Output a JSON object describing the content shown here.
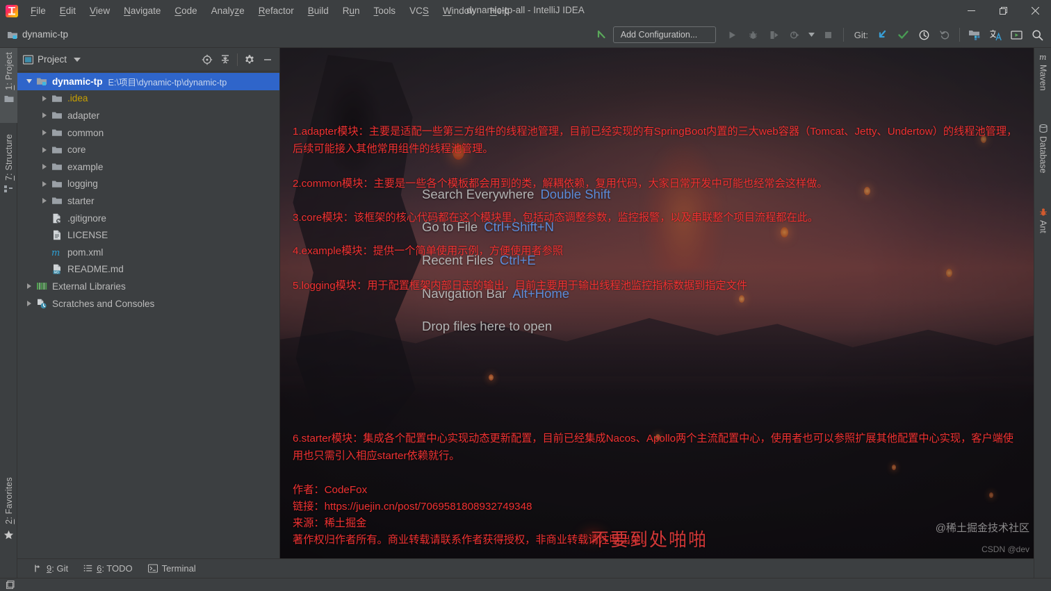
{
  "window": {
    "title": "dynamic-tp-all - IntelliJ IDEA",
    "minimize_tooltip": "Minimize",
    "restore_tooltip": "Restore",
    "close_tooltip": "Close"
  },
  "menubar": {
    "items": [
      {
        "label": "File",
        "mnemonic": "F"
      },
      {
        "label": "Edit",
        "mnemonic": "E"
      },
      {
        "label": "View",
        "mnemonic": "V"
      },
      {
        "label": "Navigate",
        "mnemonic": "N"
      },
      {
        "label": "Code",
        "mnemonic": "C"
      },
      {
        "label": "Analyze",
        "mnemonic": "z"
      },
      {
        "label": "Refactor",
        "mnemonic": "R"
      },
      {
        "label": "Build",
        "mnemonic": "B"
      },
      {
        "label": "Run",
        "mnemonic": "u"
      },
      {
        "label": "Tools",
        "mnemonic": "T"
      },
      {
        "label": "VCS",
        "mnemonic": "S"
      },
      {
        "label": "Window",
        "mnemonic": "W"
      },
      {
        "label": "Help",
        "mnemonic": "H"
      }
    ]
  },
  "toolbar": {
    "breadcrumb_project": "dynamic-tp",
    "run_configuration": "Add Configuration...",
    "git_label": "Git:",
    "icons": {
      "back": "back-arrow-icon",
      "run": "run-icon",
      "debug": "debug-icon",
      "run_coverage": "run-with-coverage-icon",
      "profile": "profiler-icon",
      "dropdown": "chevron-down-icon",
      "stop": "stop-icon",
      "update_project": "git-update-icon",
      "commit": "git-commit-icon",
      "history": "git-history-icon",
      "rollback": "git-rollback-icon",
      "project_structure": "project-structure-icon",
      "translate": "translate-icon",
      "presentation": "presentation-icon",
      "search": "search-icon"
    }
  },
  "left_stripe": {
    "items": [
      {
        "label": "1: Project",
        "mnemonic": "1",
        "icon": "project-folder-icon",
        "active": true
      },
      {
        "label": "7: Structure",
        "mnemonic": "7",
        "icon": "structure-icon",
        "active": false
      },
      {
        "label": "2: Favorites",
        "mnemonic": "2",
        "icon": "star-icon",
        "active": false
      }
    ]
  },
  "right_stripe": {
    "items": [
      {
        "label": "Maven",
        "icon": "maven-icon"
      },
      {
        "label": "Database",
        "icon": "database-icon"
      },
      {
        "label": "Ant",
        "icon": "ant-icon"
      }
    ]
  },
  "project_panel": {
    "title": "Project",
    "view_dropdown_icon": "chevron-down-icon",
    "actions": [
      {
        "name": "scroll-from-source-icon",
        "tooltip": "Select Opened File"
      },
      {
        "name": "collapse-all-icon",
        "tooltip": "Collapse All"
      },
      {
        "name": "gear-icon",
        "tooltip": "Settings"
      },
      {
        "name": "hide-icon",
        "tooltip": "Hide"
      }
    ],
    "tree": [
      {
        "label": "dynamic-tp",
        "suffix": "E:\\项目\\dynamic-tp\\dynamic-tp",
        "indent": 0,
        "twisty": "open",
        "icon": "project-folder-icon",
        "selected": true,
        "bold": true
      },
      {
        "label": ".idea",
        "suffix": "",
        "indent": 1,
        "twisty": "closed",
        "icon": "folder-icon",
        "selected": false,
        "color": "yellow"
      },
      {
        "label": "adapter",
        "suffix": "",
        "indent": 1,
        "twisty": "closed",
        "icon": "folder-icon",
        "selected": false
      },
      {
        "label": "common",
        "suffix": "",
        "indent": 1,
        "twisty": "closed",
        "icon": "folder-icon",
        "selected": false
      },
      {
        "label": "core",
        "suffix": "",
        "indent": 1,
        "twisty": "closed",
        "icon": "folder-icon",
        "selected": false
      },
      {
        "label": "example",
        "suffix": "",
        "indent": 1,
        "twisty": "closed",
        "icon": "folder-icon",
        "selected": false
      },
      {
        "label": "logging",
        "suffix": "",
        "indent": 1,
        "twisty": "closed",
        "icon": "folder-icon",
        "selected": false
      },
      {
        "label": "starter",
        "suffix": "",
        "indent": 1,
        "twisty": "closed",
        "icon": "folder-icon",
        "selected": false
      },
      {
        "label": ".gitignore",
        "suffix": "",
        "indent": 1,
        "twisty": "none",
        "icon": "gitignore-file-icon",
        "selected": false
      },
      {
        "label": "LICENSE",
        "suffix": "",
        "indent": 1,
        "twisty": "none",
        "icon": "text-file-icon",
        "selected": false
      },
      {
        "label": "pom.xml",
        "suffix": "",
        "indent": 1,
        "twisty": "none",
        "icon": "maven-pom-icon",
        "selected": false
      },
      {
        "label": "README.md",
        "suffix": "",
        "indent": 1,
        "twisty": "none",
        "icon": "markdown-file-icon",
        "selected": false
      },
      {
        "label": "External Libraries",
        "suffix": "",
        "indent": 0,
        "twisty": "closed",
        "icon": "libraries-icon",
        "selected": false
      },
      {
        "label": "Scratches and Consoles",
        "suffix": "",
        "indent": 0,
        "twisty": "closed",
        "icon": "scratches-icon",
        "selected": false
      }
    ]
  },
  "editor": {
    "red_notes": [
      "1.adapter模块：主要是适配一些第三方组件的线程池管理，目前已经实现的有SpringBoot内置的三大web容器（Tomcat、Jetty、Undertow）的线程池管理，后续可能接入其他常用组件的线程池管理。",
      "2.common模块：主要是一些各个模板都会用到的类，解耦依赖，复用代码，大家日常开发中可能也经常会这样做。",
      "3.core模块：该框架的核心代码都在这个模块里，包括动态调整参数，监控报警，以及串联整个项目流程都在此。",
      "4.example模块：提供一个简单使用示例，方便使用者参照",
      "5.logging模块：用于配置框架内部日志的输出，目前主要用于输出线程池监控指标数据到指定文件",
      "6.starter模块：集成各个配置中心实现动态更新配置，目前已经集成Nacos、Apollo两个主流配置中心，使用者也可以参照扩展其他配置中心实现，客户端使用也只需引入相应starter依赖就行。"
    ],
    "attribution": [
      "作者：CodeFox",
      "链接：https://juejin.cn/post/7069581808932749348",
      "来源：稀土掘金",
      "著作权归作者所有。商业转载请联系作者获得授权，非商业转载请注明出处。"
    ],
    "overlay_text": "不要到处啪啪",
    "hints": [
      {
        "action": "Search Everywhere",
        "shortcut": "Double Shift"
      },
      {
        "action": "Go to File",
        "shortcut": "Ctrl+Shift+N"
      },
      {
        "action": "Recent Files",
        "shortcut": "Ctrl+E"
      },
      {
        "action": "Navigation Bar",
        "shortcut": "Alt+Home"
      },
      {
        "action": "Drop files here to open",
        "shortcut": ""
      }
    ],
    "watermark_right": "@稀土掘金技术社区",
    "watermark_csdn": "CSDN @dev"
  },
  "bottom_tools": {
    "items": [
      {
        "label": "9: Git",
        "mnemonic": "9",
        "icon": "git-branch-icon"
      },
      {
        "label": "6: TODO",
        "mnemonic": "6",
        "icon": "todo-list-icon"
      },
      {
        "label": "Terminal",
        "mnemonic": "",
        "icon": "terminal-icon"
      }
    ]
  },
  "statusbar": {
    "icon": "memory-indicator-icon"
  },
  "colors": {
    "panel_bg": "#3c3f41",
    "selection_blue": "#2f65ca",
    "accent_red": "#f03131",
    "hint_key_blue": "#5b8bd8",
    "text_primary": "#bbbbbb"
  }
}
